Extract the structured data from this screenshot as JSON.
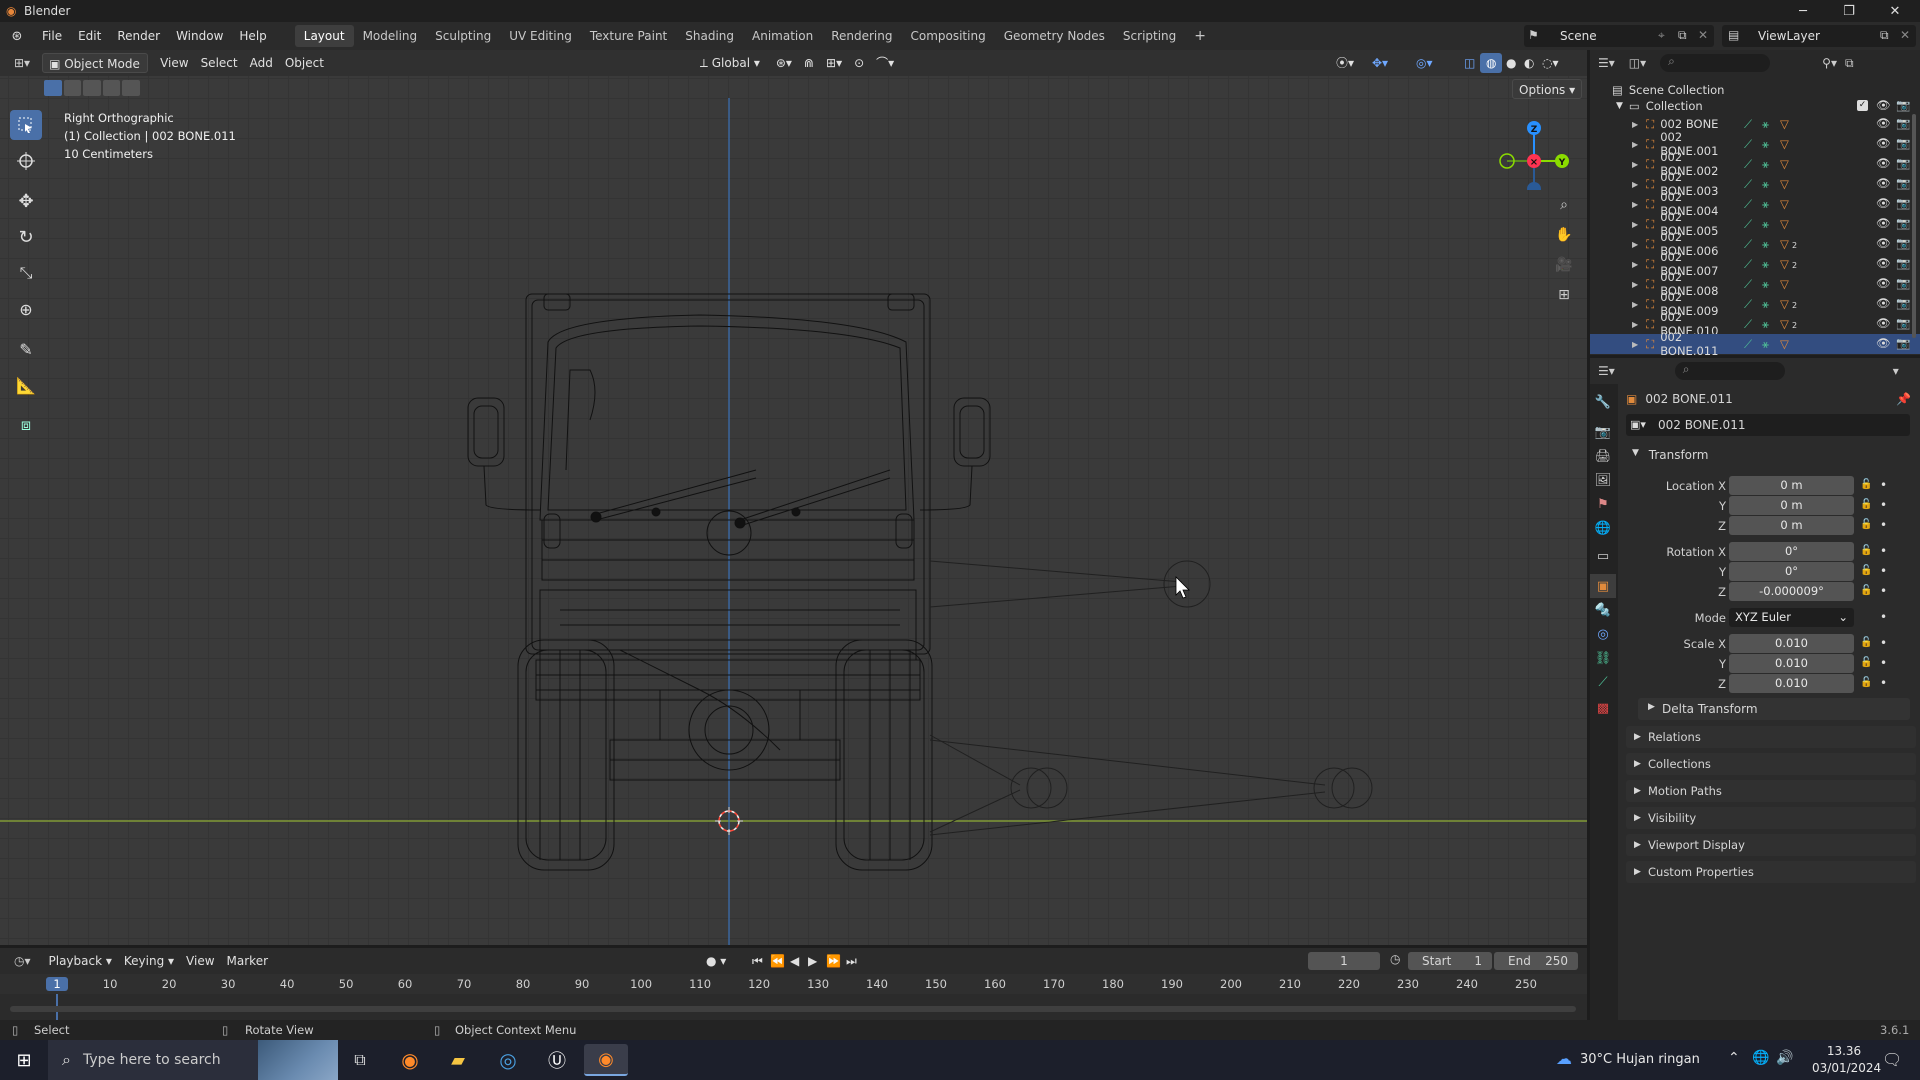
{
  "window": {
    "title": "Blender",
    "version": "3.6.1"
  },
  "menu": [
    "File",
    "Edit",
    "Render",
    "Window",
    "Help"
  ],
  "workspaces": [
    "Layout",
    "Modeling",
    "Sculpting",
    "UV Editing",
    "Texture Paint",
    "Shading",
    "Animation",
    "Rendering",
    "Compositing",
    "Geometry Nodes",
    "Scripting"
  ],
  "active_workspace": "Layout",
  "scene": {
    "name": "Scene",
    "view_layer": "ViewLayer"
  },
  "viewport": {
    "mode": "Object Mode",
    "menus": [
      "View",
      "Select",
      "Add",
      "Object"
    ],
    "orientation": "Global",
    "options_label": "Options",
    "info_line1": "Right Orthographic",
    "info_line2": "(1) Collection | 002 BONE.011",
    "info_line3": "10 Centimeters",
    "gizmo": {
      "z": "Z",
      "y": "Y"
    }
  },
  "outliner": {
    "scene_collection": "Scene Collection",
    "collection": "Collection",
    "items": [
      {
        "name": "002 BONE",
        "badge": ""
      },
      {
        "name": "002 BONE.001",
        "badge": ""
      },
      {
        "name": "002 BONE.002",
        "badge": ""
      },
      {
        "name": "002 BONE.003",
        "badge": ""
      },
      {
        "name": "002 BONE.004",
        "badge": ""
      },
      {
        "name": "002 BONE.005",
        "badge": ""
      },
      {
        "name": "002 BONE.006",
        "badge": "2"
      },
      {
        "name": "002 BONE.007",
        "badge": "2"
      },
      {
        "name": "002 BONE.008",
        "badge": ""
      },
      {
        "name": "002 BONE.009",
        "badge": "2"
      },
      {
        "name": "002 BONE.010",
        "badge": "2"
      },
      {
        "name": "002 BONE.011",
        "badge": ""
      }
    ]
  },
  "properties": {
    "object_name": "002 BONE.011",
    "object_field": "002 BONE.011",
    "transform_label": "Transform",
    "location": {
      "label": "Location X",
      "x": "0 m",
      "y": "0 m",
      "z": "0 m"
    },
    "rotation": {
      "label": "Rotation X",
      "x": "0°",
      "y": "0°",
      "z": "-0.000009°"
    },
    "mode_label": "Mode",
    "mode_value": "XYZ Euler",
    "scale": {
      "label": "Scale X",
      "x": "0.010",
      "y": "0.010",
      "z": "0.010"
    },
    "axis_y": "Y",
    "axis_z": "Z",
    "panels": [
      "Delta Transform",
      "Relations",
      "Collections",
      "Motion Paths",
      "Visibility",
      "Viewport Display",
      "Custom Properties"
    ]
  },
  "timeline": {
    "menus": [
      "Playback",
      "Keying",
      "View",
      "Marker"
    ],
    "current_frame": "1",
    "start_label": "Start",
    "start": "1",
    "end_label": "End",
    "end": "250",
    "ticks": [
      "1",
      "10",
      "20",
      "30",
      "40",
      "50",
      "60",
      "70",
      "80",
      "90",
      "100",
      "110",
      "120",
      "130",
      "140",
      "150",
      "160",
      "170",
      "180",
      "190",
      "200",
      "210",
      "220",
      "230",
      "240",
      "250"
    ]
  },
  "statusbar": {
    "select": "Select",
    "rotate": "Rotate View",
    "context": "Object Context Menu",
    "version": "3.6.1"
  },
  "taskbar": {
    "search_placeholder": "Type here to search",
    "weather": "30°C  Hujan ringan",
    "time": "13.36",
    "date": "03/01/2024"
  },
  "colors": {
    "accent": "#4a70a8",
    "x_axis": "#ff3352",
    "y_axis": "#8bdc00",
    "z_axis": "#2890ff",
    "bone_orange": "#e08a3c",
    "bone_green": "#4fc197"
  }
}
